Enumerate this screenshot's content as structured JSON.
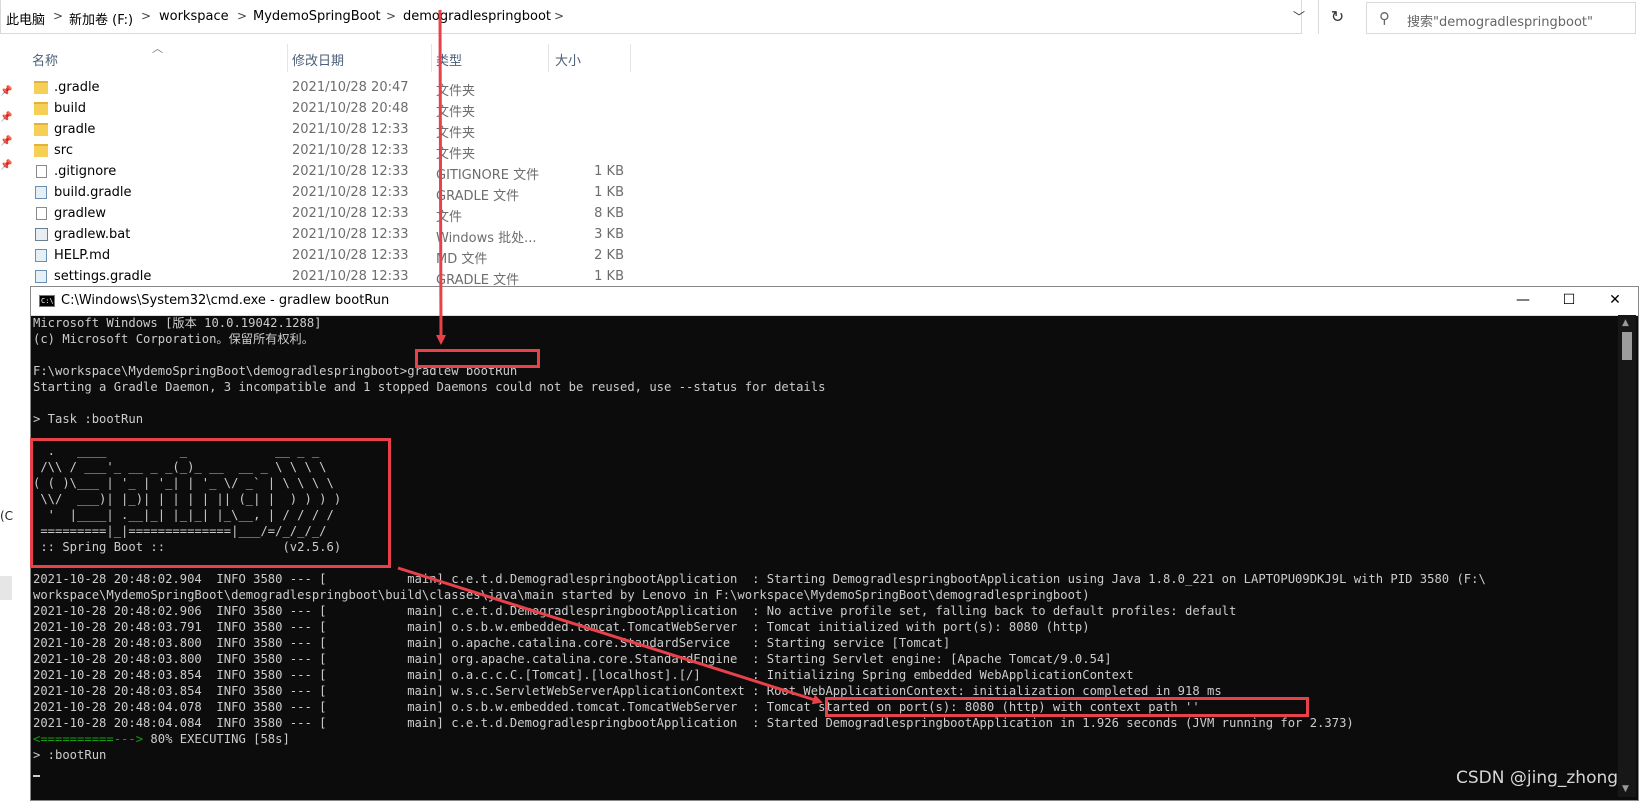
{
  "address_bar": {
    "crumbs": [
      "此电脑",
      "新加卷 (F:)",
      "workspace",
      "MydemoSpringBoot",
      "demogradlespringboot"
    ],
    "separator": ">",
    "dropdown_icon": "chevron-down-icon",
    "refresh_icon": "refresh-icon",
    "refresh_glyph": "↻",
    "search_placeholder": "搜索\"demogradlespringboot\""
  },
  "columns": {
    "name": "名称",
    "date": "修改日期",
    "type": "类型",
    "size": "大小"
  },
  "files": [
    {
      "name": ".gradle",
      "date": "2021/10/28 20:47",
      "type": "文件夹",
      "size": "",
      "icon": "folder"
    },
    {
      "name": "build",
      "date": "2021/10/28 20:48",
      "type": "文件夹",
      "size": "",
      "icon": "folder"
    },
    {
      "name": "gradle",
      "date": "2021/10/28 12:33",
      "type": "文件夹",
      "size": "",
      "icon": "folder"
    },
    {
      "name": "src",
      "date": "2021/10/28 12:33",
      "type": "文件夹",
      "size": "",
      "icon": "folder"
    },
    {
      "name": ".gitignore",
      "date": "2021/10/28 12:33",
      "type": "GITIGNORE 文件",
      "size": "1 KB",
      "icon": "doc"
    },
    {
      "name": "build.gradle",
      "date": "2021/10/28 12:33",
      "type": "GRADLE 文件",
      "size": "1 KB",
      "icon": "gradle"
    },
    {
      "name": "gradlew",
      "date": "2021/10/28 12:33",
      "type": "文件",
      "size": "8 KB",
      "icon": "doc"
    },
    {
      "name": "gradlew.bat",
      "date": "2021/10/28 12:33",
      "type": "Windows 批处...",
      "size": "3 KB",
      "icon": "bat"
    },
    {
      "name": "HELP.md",
      "date": "2021/10/28 12:33",
      "type": "MD 文件",
      "size": "2 KB",
      "icon": "gradle"
    },
    {
      "name": "settings.gradle",
      "date": "2021/10/28 12:33",
      "type": "GRADLE 文件",
      "size": "1 KB",
      "icon": "gradle"
    }
  ],
  "cmd": {
    "title": "C:\\Windows\\System32\\cmd.exe - gradlew  bootRun",
    "icon_text": "C:\\",
    "minimize": "—",
    "maximize": "☐",
    "close": "✕",
    "lines": [
      "Microsoft Windows [版本 10.0.19042.1288]",
      "(c) Microsoft Corporation。保留所有权利。",
      "",
      "F:\\workspace\\MydemoSpringBoot\\demogradlespringboot>gradlew bootRun",
      "Starting a Gradle Daemon, 3 incompatible and 1 stopped Daemons could not be reused, use --status for details",
      "",
      "> Task :bootRun",
      "",
      "  .   ____          _            __ _ _",
      " /\\\\ / ___'_ __ _ _(_)_ __  __ _ \\ \\ \\ \\",
      "( ( )\\___ | '_ | '_| | '_ \\/ _` | \\ \\ \\ \\",
      " \\\\/  ___)| |_)| | | | | || (_| |  ) ) ) )",
      "  '  |____| .__|_| |_|_| |_\\__, | / / / /",
      " =========|_|==============|___/=/_/_/_/",
      " :: Spring Boot ::                (v2.5.6)",
      "",
      "2021-10-28 20:48:02.904  INFO 3580 --- [           main] c.e.t.d.DemogradlespringbootApplication  : Starting DemogradlespringbootApplication using Java 1.8.0_221 on LAPTOPU09DKJ9L with PID 3580 (F:\\",
      "workspace\\MydemoSpringBoot\\demogradlespringboot\\build\\classes\\java\\main started by Lenovo in F:\\workspace\\MydemoSpringBoot\\demogradlespringboot)",
      "2021-10-28 20:48:02.906  INFO 3580 --- [           main] c.e.t.d.DemogradlespringbootApplication  : No active profile set, falling back to default profiles: default",
      "2021-10-28 20:48:03.791  INFO 3580 --- [           main] o.s.b.w.embedded.tomcat.TomcatWebServer  : Tomcat initialized with port(s): 8080 (http)",
      "2021-10-28 20:48:03.800  INFO 3580 --- [           main] o.apache.catalina.core.StandardService   : Starting service [Tomcat]",
      "2021-10-28 20:48:03.800  INFO 3580 --- [           main] org.apache.catalina.core.StandardEngine  : Starting Servlet engine: [Apache Tomcat/9.0.54]",
      "2021-10-28 20:48:03.854  INFO 3580 --- [           main] o.a.c.c.C.[Tomcat].[localhost].[/]       : Initializing Spring embedded WebApplicationContext",
      "2021-10-28 20:48:03.854  INFO 3580 --- [           main] w.s.c.ServletWebServerApplicationContext : Root WebApplicationContext: initialization completed in 918 ms",
      "2021-10-28 20:48:04.078  INFO 3580 --- [           main] o.s.b.w.embedded.tomcat.TomcatWebServer  : Tomcat started on port(s): 8080 (http) with context path ''",
      "2021-10-28 20:48:04.084  INFO 3580 --- [           main] c.e.t.d.DemogradlespringbootApplication  : Started DemogradlespringbootApplication in 1.926 seconds (JVM running for 2.373)",
      "<==========---> 80% EXECUTING [58s]",
      "> :bootRun"
    ],
    "progress_arrow": "<==========--->",
    "progress_rest": " 80% EXECUTING [58s]",
    "progress_color": "#13a10e"
  },
  "left_edge_text": "(C",
  "watermark": "CSDN @jing_zhong",
  "accent_color": "#e8414a"
}
